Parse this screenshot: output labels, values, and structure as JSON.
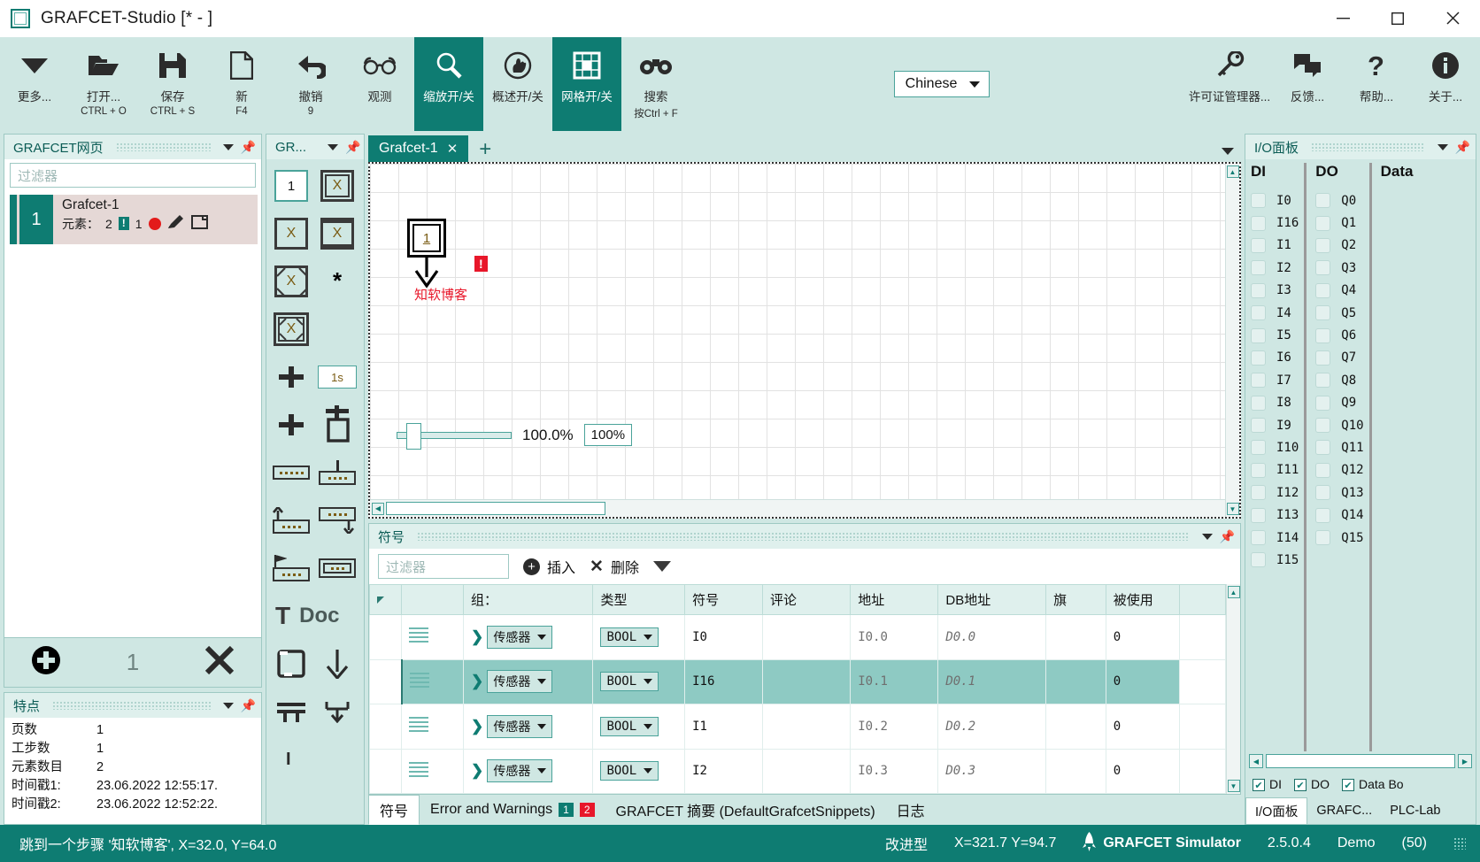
{
  "window": {
    "title": "GRAFCET-Studio [* - ]",
    "minimize": "─",
    "maximize": "☐",
    "close": "✕"
  },
  "toolbar": {
    "items": [
      {
        "label": "更多...",
        "sub": "",
        "icon": "caret-down-icon",
        "active": false
      },
      {
        "label": "打开...",
        "sub": "CTRL + O",
        "icon": "open-folder-icon",
        "active": false
      },
      {
        "label": "保存",
        "sub": "CTRL + S",
        "icon": "save-disk-icon",
        "active": false
      },
      {
        "label": "新",
        "sub": "F4",
        "icon": "new-document-icon",
        "active": false
      },
      {
        "label": "撤销",
        "sub": "9",
        "icon": "undo-arrow-icon",
        "active": false
      },
      {
        "label": "观测",
        "sub": "",
        "icon": "glasses-icon",
        "active": false
      },
      {
        "label": "缩放开/关",
        "sub": "",
        "icon": "magnifier-icon",
        "active": true
      },
      {
        "label": "概述开/关",
        "sub": "",
        "icon": "hand-circle-icon",
        "active": false
      },
      {
        "label": "网格开/关",
        "sub": "",
        "icon": "grid-icon",
        "active": true
      },
      {
        "label": "搜索",
        "sub": "按Ctrl + F",
        "icon": "binoculars-icon",
        "active": false
      }
    ],
    "language": "Chinese",
    "right_items": [
      {
        "label": "许可证管理器...",
        "icon": "key-icon"
      },
      {
        "label": "反馈...",
        "icon": "feedback-bubbles-icon"
      },
      {
        "label": "帮助...",
        "icon": "question-mark-icon"
      },
      {
        "label": "关于...",
        "icon": "info-icon"
      }
    ]
  },
  "pages_panel": {
    "title": "GRAFCET网页",
    "filter_placeholder": "过滤器",
    "item": {
      "number": "1",
      "name": "Grafcet-1",
      "elements_label": "元素：",
      "elements_count": "2",
      "warn_badge": "!",
      "warn_count": "1"
    },
    "footer_count": "1",
    "add_icon": "plus-circle-icon",
    "remove_icon": "close-x-icon"
  },
  "features_panel": {
    "title": "特点",
    "rows": [
      {
        "key": "页数",
        "value": "1"
      },
      {
        "key": "工步数",
        "value": "1"
      },
      {
        "key": "元素数目",
        "value": "2"
      },
      {
        "key": "时间戳1:",
        "value": "23.06.2022 12:55:17."
      },
      {
        "key": "时间戳2:",
        "value": "23.06.2022 12:52:22."
      }
    ]
  },
  "toolbox": {
    "title": "GR...",
    "time_value": "1s",
    "doc_label": "Doc",
    "text_icon_label": "T",
    "star_label": "*",
    "x_label": "X",
    "step_label": "1",
    "bar_label": "I"
  },
  "editor": {
    "tab_name": "Grafcet-1",
    "tab_close": "✕",
    "tab_add": "+",
    "step": {
      "number": "1",
      "warn": "!",
      "label": "知软博客"
    },
    "zoom_percent_text": "100.0%",
    "zoom_box_value": "100%"
  },
  "symbols_panel": {
    "title": "符号",
    "filter_placeholder": "过滤器",
    "insert_label": "插入",
    "delete_label": "删除",
    "columns": [
      "",
      "",
      "组：",
      "类型",
      "符号",
      "评论",
      "地址",
      "DB地址",
      "旗",
      "被使用"
    ],
    "rows": [
      {
        "group": "传感器",
        "type": "BOOL",
        "symbol": "I0",
        "comment": "",
        "address": "I0.0",
        "db_address": "D0.0",
        "flag": "",
        "used": "0",
        "selected": false
      },
      {
        "group": "传感器",
        "type": "BOOL",
        "symbol": "I16",
        "comment": "",
        "address": "I0.1",
        "db_address": "D0.1",
        "flag": "",
        "used": "0",
        "selected": true
      },
      {
        "group": "传感器",
        "type": "BOOL",
        "symbol": "I1",
        "comment": "",
        "address": "I0.2",
        "db_address": "D0.2",
        "flag": "",
        "used": "0",
        "selected": false
      },
      {
        "group": "传感器",
        "type": "BOOL",
        "symbol": "I2",
        "comment": "",
        "address": "I0.3",
        "db_address": "D0.3",
        "flag": "",
        "used": "0",
        "selected": false
      }
    ]
  },
  "bottom_tabs": {
    "symbols": "符号",
    "errors": "Error and Warnings",
    "errors_green_count": "1",
    "errors_red_count": "2",
    "summary": "GRAFCET 摘要 (DefaultGrafcetSnippets)",
    "log": "日志"
  },
  "io_panel": {
    "title": "I/O面板",
    "columns": [
      {
        "name": "DI",
        "items": [
          "I0",
          "I16",
          "I1",
          "I2",
          "I3",
          "I4",
          "I5",
          "I6",
          "I7",
          "I8",
          "I9",
          "I10",
          "I11",
          "I12",
          "I13",
          "I14",
          "I15"
        ]
      },
      {
        "name": "DO",
        "items": [
          "Q0",
          "Q1",
          "Q2",
          "Q3",
          "Q4",
          "Q5",
          "Q6",
          "Q7",
          "Q8",
          "Q9",
          "Q10",
          "Q11",
          "Q12",
          "Q13",
          "Q14",
          "Q15"
        ]
      },
      {
        "name": "Data",
        "items": []
      }
    ],
    "checks": [
      {
        "label": "DI",
        "checked": true
      },
      {
        "label": "DO",
        "checked": true
      },
      {
        "label": "Data Bo",
        "checked": true
      }
    ],
    "tabs": [
      {
        "label": "I/O面板",
        "active": true
      },
      {
        "label": "GRAFC...",
        "active": false
      },
      {
        "label": "PLC-Lab",
        "active": false
      }
    ]
  },
  "statusbar": {
    "message": "跳到一个步骤 '知软博客', X=32.0, Y=64.0",
    "mode": "改进型",
    "coords": "X=321.7  Y=94.7",
    "product": "GRAFCET Simulator",
    "version": "2.5.0.4",
    "license": "Demo",
    "license_count": "(50)"
  },
  "colors": {
    "accent": "#0e7c72",
    "ribbon_bg": "#cfe7e3",
    "panel_head": "#dff0ed",
    "alert_red": "#e8172a",
    "row_selected": "#8ecac3"
  }
}
